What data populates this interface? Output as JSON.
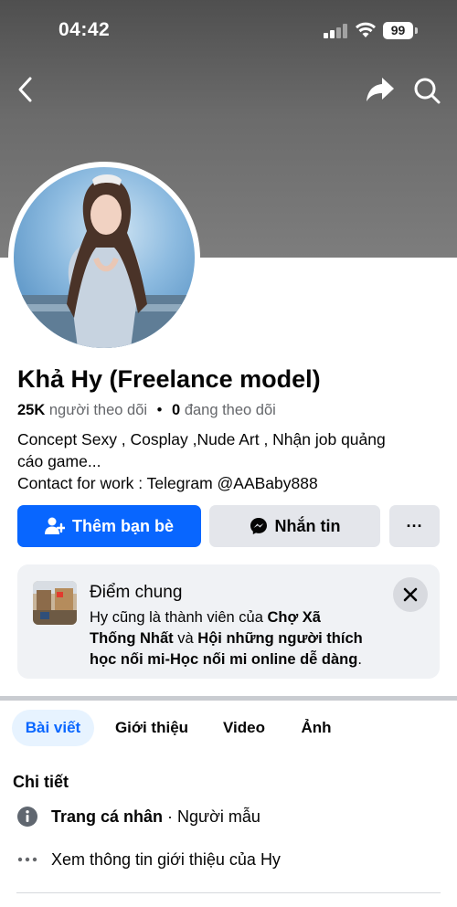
{
  "status_bar": {
    "time": "04:42",
    "battery": "99"
  },
  "profile": {
    "name": "Khả Hy (Freelance model)",
    "followers_count": "25K",
    "followers_label": "người theo dõi",
    "following_count": "0",
    "following_label": "đang theo dõi",
    "bio_line_1": "Concept Sexy , Cosplay ,Nude Art , Nhận job quảng",
    "bio_line_2": "cáo game...",
    "bio_line_3": "Contact for work : Telegram @AABaby888"
  },
  "actions": {
    "add_friend": "Thêm bạn bè",
    "message": "Nhắn tin",
    "more": "···"
  },
  "mutual": {
    "title": "Điểm chung",
    "prefix": "Hy cũng là thành viên của",
    "group_1_part_1": "Chợ Xã",
    "group_1_part_2": "Thống Nhất",
    "joiner": "và",
    "group_2_part_1": "Hội những người thích",
    "group_2_part_2": "học nối mi-Học nối mi online dễ dàng",
    "suffix": "."
  },
  "tabs": [
    {
      "label": "Bài viết",
      "active": true
    },
    {
      "label": "Giới thiệu",
      "active": false
    },
    {
      "label": "Video",
      "active": false
    },
    {
      "label": "Ảnh",
      "active": false
    }
  ],
  "details": {
    "title": "Chi tiết",
    "page_type_label": "Trang cá nhân",
    "page_type_value": "· Người mẫu",
    "see_about": "Xem thông tin giới thiệu của Hy"
  },
  "colors": {
    "accent": "#0866ff",
    "accent_light": "#e7f3ff",
    "secondary_button": "#e4e6eb",
    "card_bg": "#f0f2f5",
    "muted_text": "#65676b"
  }
}
